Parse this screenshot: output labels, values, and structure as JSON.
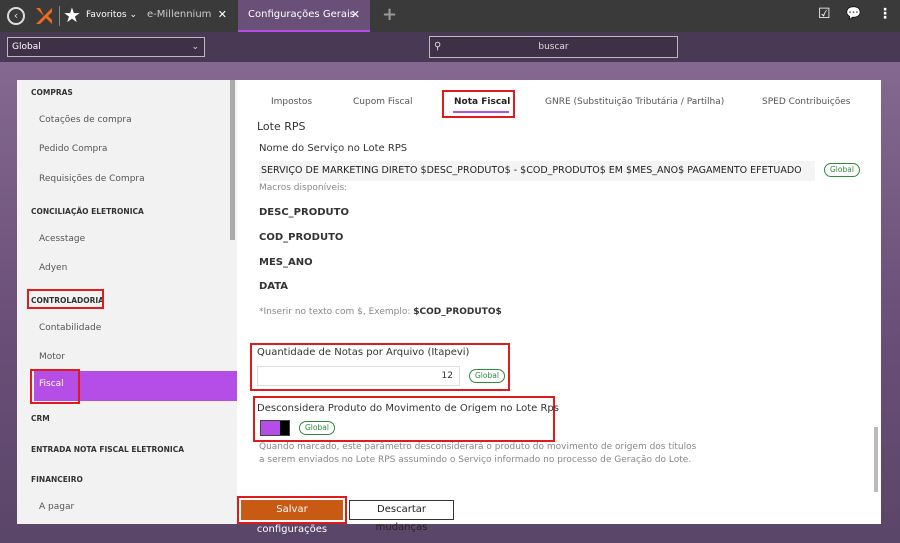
{
  "topbar": {
    "favorites_label": "Favoritos",
    "tabs": [
      {
        "label": "e-Millennium",
        "close": "✕"
      },
      {
        "label": "Configurações Gerais",
        "close": "✕"
      }
    ],
    "add_tab": "+",
    "back_icon": "‹",
    "star_icon": "★",
    "checklist_icon": "☑",
    "chat_icon": "💬",
    "menu_icon": "⋮"
  },
  "toolbar": {
    "scope_select": "Global",
    "search_placeholder": "buscar"
  },
  "sidebar": {
    "sections": [
      {
        "title": "COMPRAS",
        "items": [
          "Cotações de compra",
          "Pedido Compra",
          "Requisições de Compra"
        ]
      },
      {
        "title": "CONCILIAÇÃO ELETRONICA",
        "items": [
          "Acesstage",
          "Adyen"
        ]
      },
      {
        "title": "CONTROLADORIA",
        "items": [
          "Contabilidade",
          "Motor",
          "Fiscal"
        ]
      },
      {
        "title": "CRM",
        "items": []
      },
      {
        "title": "ENTRADA NOTA FISCAL ELETRONICA",
        "items": []
      },
      {
        "title": "FINANCEIRO",
        "items": [
          "A pagar"
        ]
      }
    ],
    "active_item": "Fiscal"
  },
  "content_tabs": [
    "Impostos",
    "Cupom Fiscal",
    "Nota Fiscal",
    "GNRE (Substituição Tributária / Partilha)",
    "SPED Contribuições"
  ],
  "active_tab": "Nota Fiscal",
  "form": {
    "section_title": "Lote RPS",
    "service_name_label": "Nome do Serviço no Lote RPS",
    "service_name_value": "SERVIÇO DE MARKETING DIRETO $DESC_PRODUTO$ - $COD_PRODUTO$ EM $MES_ANO$ PAGAMENTO EFETUADO",
    "scope_badge": "Global",
    "macros_label": "Macros disponíveis:",
    "macros": [
      "DESC_PRODUTO",
      "COD_PRODUTO",
      "MES_ANO",
      "DATA"
    ],
    "hint_prefix": "*Inserir no texto com $, Exemplo: ",
    "hint_example": "$COD_PRODUTO$",
    "qty_label": "Quantidade de Notas por Arquivo (Itapevi)",
    "qty_value": "12",
    "ignore_label": "Desconsidera Produto do Movimento de Origem no Lote Rps",
    "ignore_toggle_on": true,
    "ignore_desc": "Quando marcado, este parâmetro desconsiderará o produto do movimento de origem dos títulos a serem enviados no Lote RPS assumindo o Serviço informado no processo de Geração do Lote."
  },
  "actions": {
    "save_label": "Salvar configurações",
    "discard_label": "Descartar mudanças"
  },
  "colors": {
    "accent": "#b44ee6",
    "save": "#c85a14",
    "badge": "#2e8b3e",
    "highlight": "#e01b1b"
  }
}
